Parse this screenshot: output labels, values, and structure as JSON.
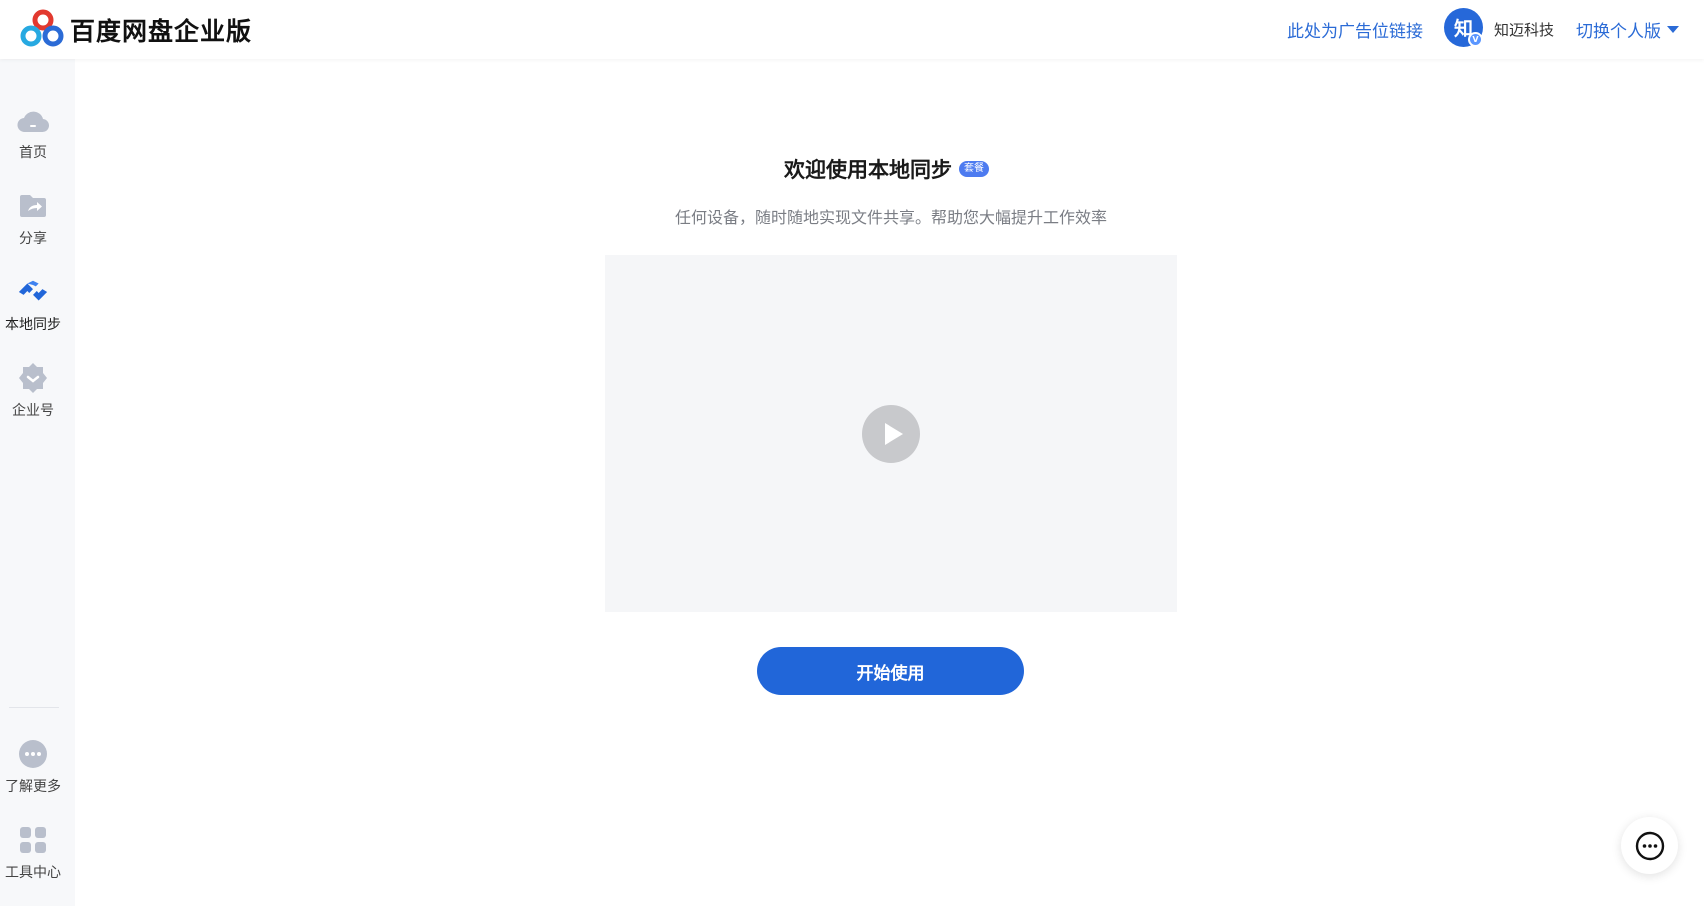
{
  "header": {
    "brand": "百度网盘企业版",
    "ad_link": "此处为广告位链接",
    "avatar_char": "知",
    "avatar_badge": "V",
    "company": "知迈科技",
    "switch_label": "切换个人版"
  },
  "sidebar": {
    "items": [
      {
        "label": "首页",
        "icon": "cloud-icon"
      },
      {
        "label": "分享",
        "icon": "share-folder-icon"
      },
      {
        "label": "本地同步",
        "icon": "sync-icon"
      },
      {
        "label": "企业号",
        "icon": "enterprise-badge-icon"
      }
    ],
    "bottom_items": [
      {
        "label": "了解更多",
        "icon": "more-icon"
      },
      {
        "label": "工具中心",
        "icon": "grid-icon"
      }
    ]
  },
  "main": {
    "title": "欢迎使用本地同步",
    "tag": "套餐",
    "subtitle": "任何设备，随时随地实现文件共享。帮助您大幅提升工作效率",
    "start_button": "开始使用"
  },
  "colors": {
    "accent": "#2166d9",
    "link": "#2b6bd6",
    "sidebar_bg": "#f7f8fa",
    "tag_bg": "#4d7bf0"
  }
}
